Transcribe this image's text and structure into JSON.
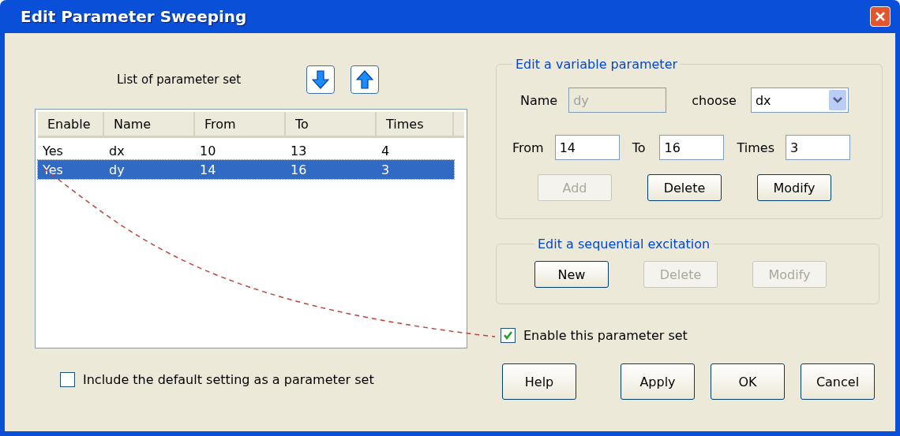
{
  "window": {
    "title": "Edit Parameter Sweeping"
  },
  "list": {
    "label": "List of parameter set",
    "columns": [
      "Enable",
      "Name",
      "From",
      "To",
      "Times"
    ],
    "rows": [
      {
        "cells": [
          "Yes",
          "dx",
          "10",
          "13",
          "4"
        ],
        "selected": false
      },
      {
        "cells": [
          "Yes",
          "dy",
          "14",
          "16",
          "3"
        ],
        "selected": true
      }
    ]
  },
  "include_default": {
    "label": "Include the default setting as a parameter set",
    "checked": false
  },
  "variable_group": {
    "title": "Edit a variable parameter",
    "name_label": "Name",
    "name_value": "dy",
    "name_disabled": true,
    "choose_label": "choose",
    "choose_value": "dx",
    "from_label": "From",
    "from_value": "14",
    "to_label": "To",
    "to_value": "16",
    "times_label": "Times",
    "times_value": "3",
    "buttons": [
      {
        "label": "Add",
        "disabled": true
      },
      {
        "label": "Delete",
        "disabled": false
      },
      {
        "label": "Modify",
        "disabled": false
      }
    ]
  },
  "excitation_group": {
    "title": "Edit a sequential excitation",
    "buttons": [
      {
        "label": "New",
        "disabled": false
      },
      {
        "label": "Delete",
        "disabled": true
      },
      {
        "label": "Modify",
        "disabled": true
      }
    ]
  },
  "enable_set": {
    "label": "Enable this parameter set",
    "checked": true
  },
  "footer_buttons": [
    "Help",
    "Apply",
    "OK",
    "Cancel"
  ]
}
